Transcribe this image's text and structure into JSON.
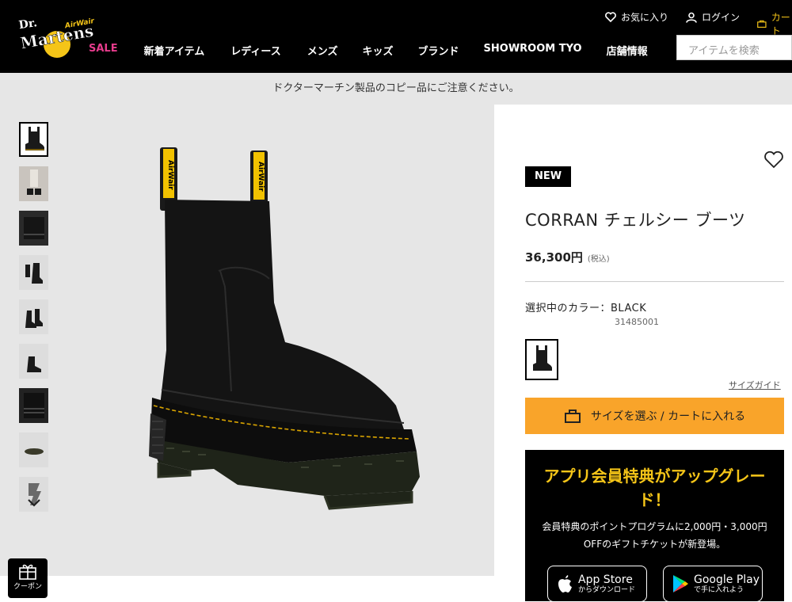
{
  "header": {
    "logo_text": "Dr. Martens AirWair",
    "utility": {
      "favorites": "お気に入り",
      "login": "ログイン",
      "cart": "カート"
    },
    "nav": [
      {
        "label": "SALE"
      },
      {
        "label": "新着アイテム"
      },
      {
        "label": "レディース"
      },
      {
        "label": "メンズ"
      },
      {
        "label": "キッズ"
      },
      {
        "label": "ブランド"
      },
      {
        "label": "SHOWROOM TYO"
      },
      {
        "label": "店舗情報"
      }
    ],
    "search_placeholder": "アイテムを検索"
  },
  "notice": "ドクターマーチン製品のコピー品にご注意ください。",
  "gallery": {
    "thumb_count": 9,
    "active_index": 0
  },
  "product": {
    "badge": "NEW",
    "title": "CORRAN チェルシー ブーツ",
    "price": "36,300円",
    "tax_note": "(税込)",
    "color_label": "選択中のカラー：BLACK",
    "sku": "31485001",
    "size_guide": "サイズガイド",
    "cart_button": "サイズを選ぶ / カートに入れる"
  },
  "promo": {
    "heading": "アプリ会員特典がアップグレード！",
    "text": "会員特典のポイントプログラムに2,000円・3,000円OFFのギフトチケットが新登場。",
    "app_store": {
      "big": "App Store",
      "small": "からダウンロード"
    },
    "google_play": {
      "big": "Google Play",
      "small": "で手に入れよう"
    }
  },
  "coupon": "クーポン",
  "colors": {
    "accent": "#f9a42a",
    "sale": "#e63c8c",
    "promo_heading": "#f5c518",
    "header_bg": "#000000"
  }
}
